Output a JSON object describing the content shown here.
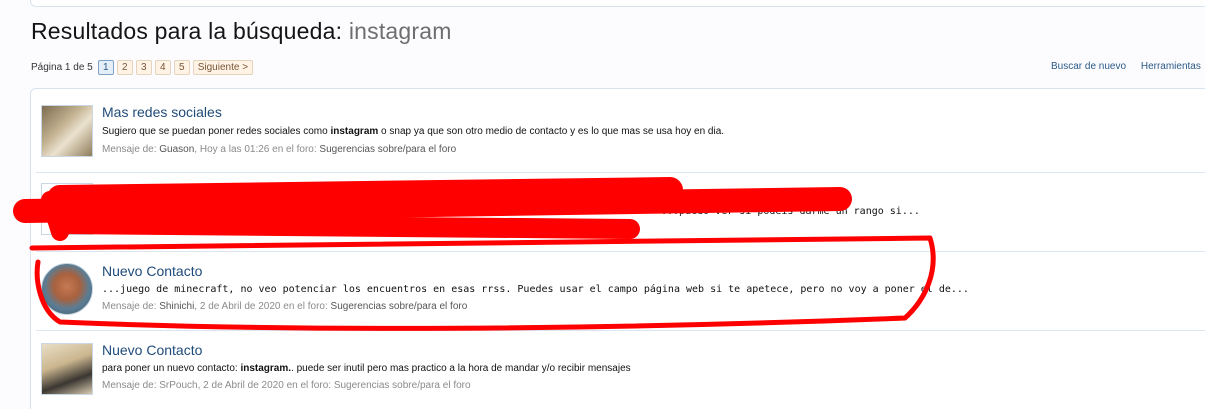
{
  "page": {
    "title_prefix": "Resultados para la búsqueda:",
    "query": "instagram"
  },
  "pagination": {
    "label": "Página 1 de 5",
    "pages": [
      "1",
      "2",
      "3",
      "4",
      "5"
    ],
    "next": "Siguiente >"
  },
  "links": {
    "search_again": "Buscar de nuevo",
    "tools": "Herramientas"
  },
  "results": [
    {
      "title": "Mas redes sociales",
      "snippet_before": "Sugiero que se puedan poner redes sociales como ",
      "snippet_bold": "instagram",
      "snippet_after": " o snap ya que son otro medio de contacto y es lo que mas se usa hoy en dia.",
      "meta_prefix": "Mensaje de:",
      "author": "Guason",
      "date": "Hoy a las 01:26",
      "forum_prefix": "en el foro:",
      "forum": "Sugerencias sobre/para el foro"
    },
    {
      "snippet_visible": "...puedo ver si podeis darme un rango si..."
    },
    {
      "title": "Nuevo Contacto",
      "snippet": "...juego de minecraft, no veo potenciar los encuentros en esas rrss. Puedes usar el campo página web si te apetece, pero no voy a poner el de...",
      "meta_prefix": "Mensaje de:",
      "author": "Shinichi",
      "date": "2 de Abril de 2020",
      "forum_prefix": "en el foro:",
      "forum": "Sugerencias sobre/para el foro"
    },
    {
      "title": "Nuevo Contacto",
      "snippet_before": "para poner un nuevo contacto: ",
      "snippet_bold": "instagram.",
      "snippet_after": ". puede ser inutil pero mas practico a la hora de mandar y/o recibir mensajes",
      "meta_text": "Mensaje de: SrPouch, 2 de Abril de 2020 en el foro: Sugerencias sobre/para el foro"
    }
  ],
  "colors": {
    "link": "#1f4b7a",
    "annotation": "#ff0000",
    "meta": "#8b8b8b"
  }
}
